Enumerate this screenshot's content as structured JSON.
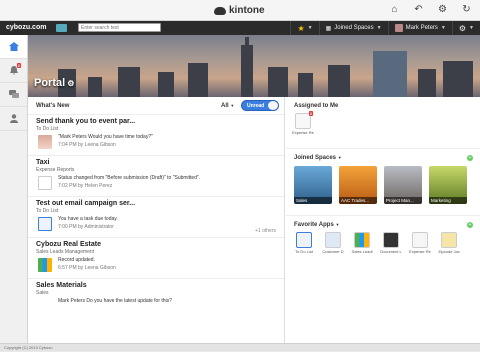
{
  "app": {
    "name": "kintone"
  },
  "header": {
    "brand": "cybozu.com",
    "search_placeholder": "Enter search text",
    "joined_spaces": "Joined Spaces",
    "user_name": "Mark Peters"
  },
  "rail": {
    "badge_count": "2"
  },
  "portal": {
    "title": "Portal"
  },
  "whats_new": {
    "title": "What's New",
    "filter": "All",
    "unread_label": "Unread",
    "items": [
      {
        "title": "Send thank you to event par...",
        "app": "To Do List",
        "text": "\"Mark Peters Would you have time today?\"",
        "time": "7:04 PM",
        "by": "by Leena Gibson",
        "others": ""
      },
      {
        "title": "Taxi",
        "app": "Expense Reports",
        "text": "Status changed from \"Before submission (Draft)\" to \"Submitted\".",
        "time": "7:02 PM",
        "by": "by Helen Perez",
        "others": ""
      },
      {
        "title": "Test out email campaign ser...",
        "app": "To Do List",
        "text": "You have a task due today.",
        "time": "7:00 PM",
        "by": "by Administrator",
        "others": "+1 others"
      },
      {
        "title": "Cybozu Real Estate",
        "app": "Sales Leads Management",
        "text": "Record updated.",
        "time": "6:57 PM",
        "by": "by Leena Gibson",
        "others": ""
      },
      {
        "title": "Sales Materials",
        "app": "Sales",
        "text": "Mark Peters Do you have the latest update for this?",
        "time": "",
        "by": "",
        "others": ""
      }
    ]
  },
  "assigned": {
    "title": "Assigned to Me",
    "apps": [
      {
        "label": "Expense Re",
        "badge": "2"
      }
    ]
  },
  "joined_spaces": {
    "title": "Joined Spaces",
    "spaces": [
      {
        "label": "Sales"
      },
      {
        "label": "AAC Trades..."
      },
      {
        "label": "Project Man..."
      },
      {
        "label": "Marketing"
      }
    ]
  },
  "favorite_apps": {
    "title": "Favorite Apps",
    "apps": [
      {
        "label": "To Do List"
      },
      {
        "label": "Customer D"
      },
      {
        "label": "Sales Leadi"
      },
      {
        "label": "Document L"
      },
      {
        "label": "Expense Re"
      },
      {
        "label": "Zipcode Jav"
      }
    ]
  },
  "footer": {
    "text": "Copyright (C) 2013 Cybozu"
  },
  "colors": {
    "accent": "#3a7ee0",
    "header": "#2b2b2b",
    "badge": "#e33333"
  }
}
